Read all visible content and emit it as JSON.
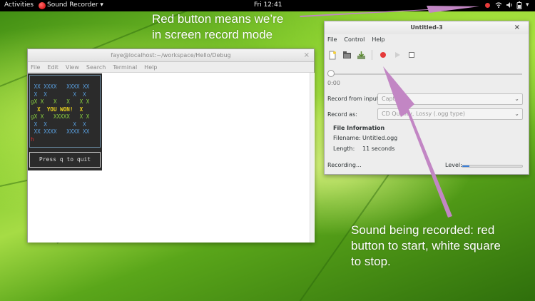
{
  "topbar": {
    "activities": "Activities",
    "app_menu": "Sound Recorder ▾",
    "clock": "Fri 12:41",
    "tray_icons": [
      "record-indicator-icon",
      "wifi-icon",
      "volume-icon",
      "battery-icon",
      "power-icon"
    ]
  },
  "annotations": {
    "top_line1": "Red button means we’re",
    "top_line2": "in screen record mode",
    "bottom_line1": "Sound being recorded: red",
    "bottom_line2": "button to start, white square",
    "bottom_line3": "to stop."
  },
  "terminal": {
    "title": "faye@localhost:~/workspace/Hello/Debug",
    "menu": [
      "File",
      "Edit",
      "View",
      "Search",
      "Terminal",
      "Help"
    ],
    "game_lines": [
      " XX XXXX   XXXX XX",
      " X  X        X  X",
      "gX X   X   X   X X",
      "  X  YOU WON!  X",
      "gX X   XXXXX   X X",
      " X  X        X  X",
      " XX XXXX   XXXX XX",
      "h"
    ],
    "win_text": "YOU WON!",
    "quit_text": "Press q to quit"
  },
  "recorder": {
    "title": "Untitled-3",
    "menu": [
      "File",
      "Control",
      "Help"
    ],
    "toolbar": [
      "new-icon",
      "open-icon",
      "save-icon",
      "record-icon",
      "play-icon",
      "stop-icon"
    ],
    "time": "0:00",
    "record_from_label": "Record from input:",
    "record_from_value": "Capture",
    "record_as_label": "Record as:",
    "record_as_value": "CD Quality, Lossy (.ogg type)",
    "file_info_title": "File Information",
    "filename_label": "Filename:",
    "filename_value": "Untitled.ogg",
    "length_label": "Length:",
    "length_value": "11 seconds",
    "status": "Recording...",
    "level_label": "Level:",
    "level": 0.12
  },
  "colors": {
    "record_red": "#e53a3a",
    "arrow_violet": "#c286c4",
    "level_blue": "#3b7fd8"
  }
}
